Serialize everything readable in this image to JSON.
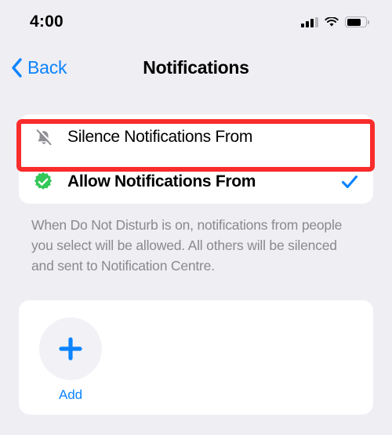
{
  "status_bar": {
    "time": "4:00",
    "cellular_icon": "signal-bars-icon",
    "cellular_bars_active": 3,
    "cellular_bars_total": 4,
    "wifi_icon": "wifi-icon",
    "battery_icon": "battery-icon",
    "battery_level_percent": 75
  },
  "nav": {
    "back_label": "Back",
    "back_icon": "chevron-left-icon",
    "title": "Notifications"
  },
  "options": {
    "rows": [
      {
        "label": "Silence Notifications From",
        "icon": "bell-slash-icon",
        "selected": false,
        "highlighted": true
      },
      {
        "label": "Allow Notifications From",
        "icon": "green-seal-checkmark-icon",
        "selected": true,
        "highlighted": false
      }
    ]
  },
  "footer": {
    "text": "When Do Not Disturb is on, notifications from people you select will be allowed. All others will be silenced and sent to Notification Centre."
  },
  "add_section": {
    "plus_icon": "plus-icon",
    "label": "Add"
  },
  "colors": {
    "background": "#EFEEF3",
    "card": "#FFFFFF",
    "accent_blue": "#0B84FE",
    "green": "#34C759",
    "gray_icon": "#8E8E93",
    "footer_gray": "#8A8A8E",
    "highlight_red": "#F92C2C"
  }
}
